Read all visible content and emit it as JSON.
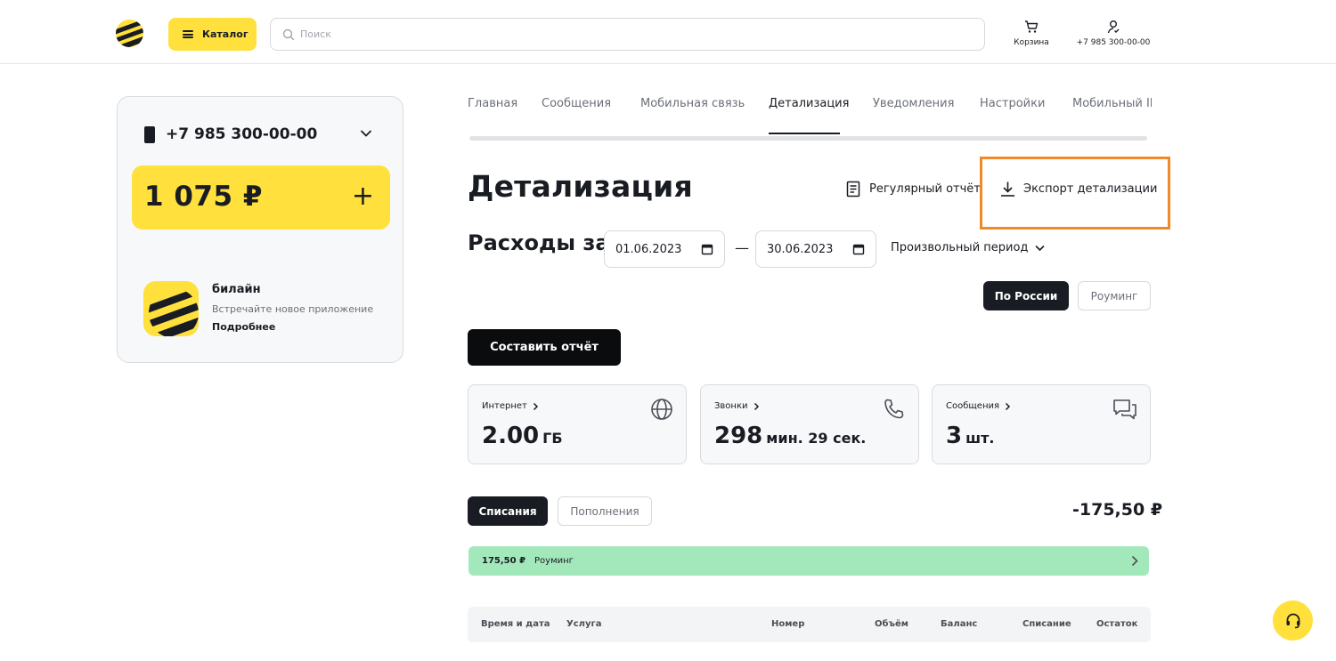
{
  "header": {
    "catalog_label": "Каталог",
    "search_placeholder": "Поиск",
    "cart_label": "Корзина",
    "profile_label": "+7 985 300-00-00"
  },
  "sidebar": {
    "phone_number": "+7 985 300-00-00",
    "balance": "1 075 ₽",
    "add_symbol": "+",
    "promo": {
      "title": "билайн",
      "subtitle": "Встречайте новое приложение",
      "link": "Подробнее"
    }
  },
  "tabs": [
    {
      "label": "Главная",
      "active": false
    },
    {
      "label": "Сообщения",
      "active": false
    },
    {
      "label": "Мобильная связь",
      "active": false
    },
    {
      "label": "Детализация",
      "active": true
    },
    {
      "label": "Уведомления",
      "active": false
    },
    {
      "label": "Настройки",
      "active": false
    },
    {
      "label": "Мобильный ID",
      "active": false
    }
  ],
  "main": {
    "title": "Детализация",
    "regular_report": "Регулярный отчёт",
    "export": "Экспорт детализации",
    "expenses_label": "Расходы за",
    "date_from": "01.06.2023",
    "date_to": "30.06.2023",
    "dash": "—",
    "period": "Произвольный период",
    "region_russia": "По России",
    "region_roaming": "Роуминг",
    "make_report": "Составить отчёт"
  },
  "stats": [
    {
      "label": "Интернет",
      "value": "2.00",
      "unit": "ГБ",
      "icon": "globe-icon"
    },
    {
      "label": "Звонки",
      "value": "298",
      "unit": "мин. 29 сек.",
      "icon": "phone-icon"
    },
    {
      "label": "Сообщения",
      "value": "3",
      "unit": "шт.",
      "icon": "chat-icon"
    }
  ],
  "filters": {
    "writeoffs": "Списания",
    "topups": "Пополнения",
    "total": "-175,50 ₽"
  },
  "roaming_row": {
    "amount": "175,50 ₽",
    "label": "Роуминг"
  },
  "table": {
    "columns": [
      "Время и дата",
      "Услуга",
      "Номер",
      "Объём",
      "Баланс",
      "Списание",
      "Остаток"
    ]
  },
  "colors": {
    "brand_yellow": "#ffe03d",
    "dark": "#191c22",
    "roaming_green": "#a3e8ba",
    "highlight_orange": "#f08a28"
  }
}
